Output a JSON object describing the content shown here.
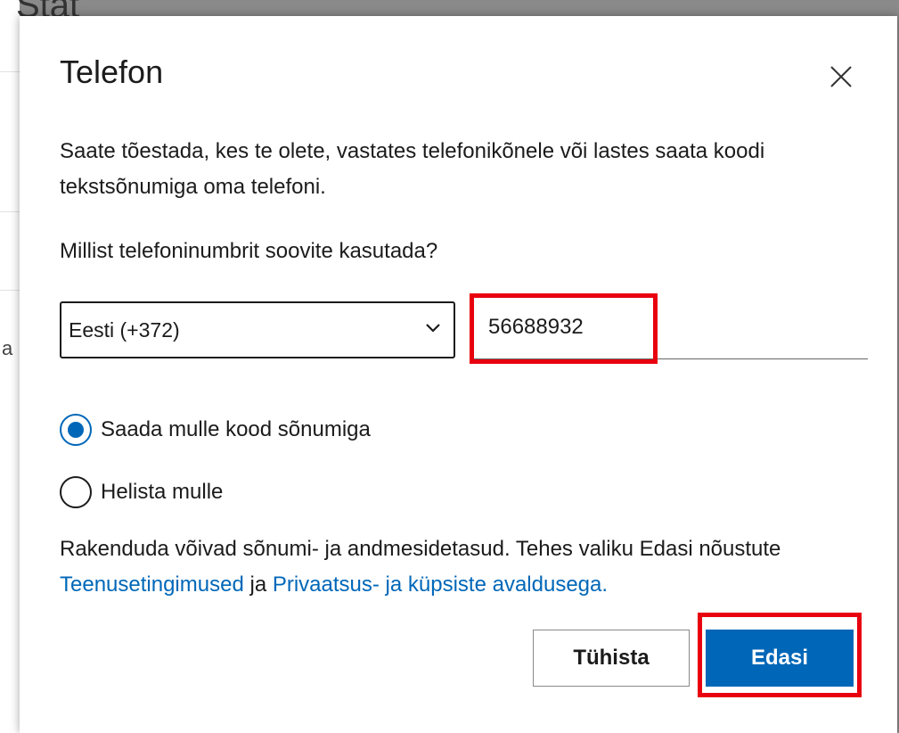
{
  "background": {
    "partial_texts": [
      "Stat",
      "a"
    ]
  },
  "dialog": {
    "title": "Telefon",
    "close_label": "×",
    "description": "Saate tõestada, kes te olete, vastates telefonikõnele või lastes saata koodi tekstsõnumiga oma telefoni.",
    "question": "Millist telefoninumbrit soovite kasutada?",
    "country_select": {
      "value": "Eesti (+372)"
    },
    "phone_input": {
      "value": "56688932"
    },
    "options": [
      {
        "label": "Saada mulle kood sõnumiga",
        "checked": true
      },
      {
        "label": "Helista mulle",
        "checked": false
      }
    ],
    "legal": {
      "prefix": "Rakenduda võivad sõnumi- ja andmesidetasud. Tehes valiku Edasi nõustute ",
      "terms_link": "Teenusetingimused",
      "middle": " ja ",
      "privacy_link": "Privaatsus- ja küpsiste avaldusega."
    },
    "buttons": {
      "cancel": "Tühista",
      "next": "Edasi"
    }
  },
  "colors": {
    "accent": "#0067b8",
    "highlight": "#e8000f",
    "overlay": "#8a8a8a"
  },
  "icons": [
    "close-icon",
    "chevron-down-icon",
    "radio-checked-icon",
    "radio-unchecked-icon"
  ]
}
